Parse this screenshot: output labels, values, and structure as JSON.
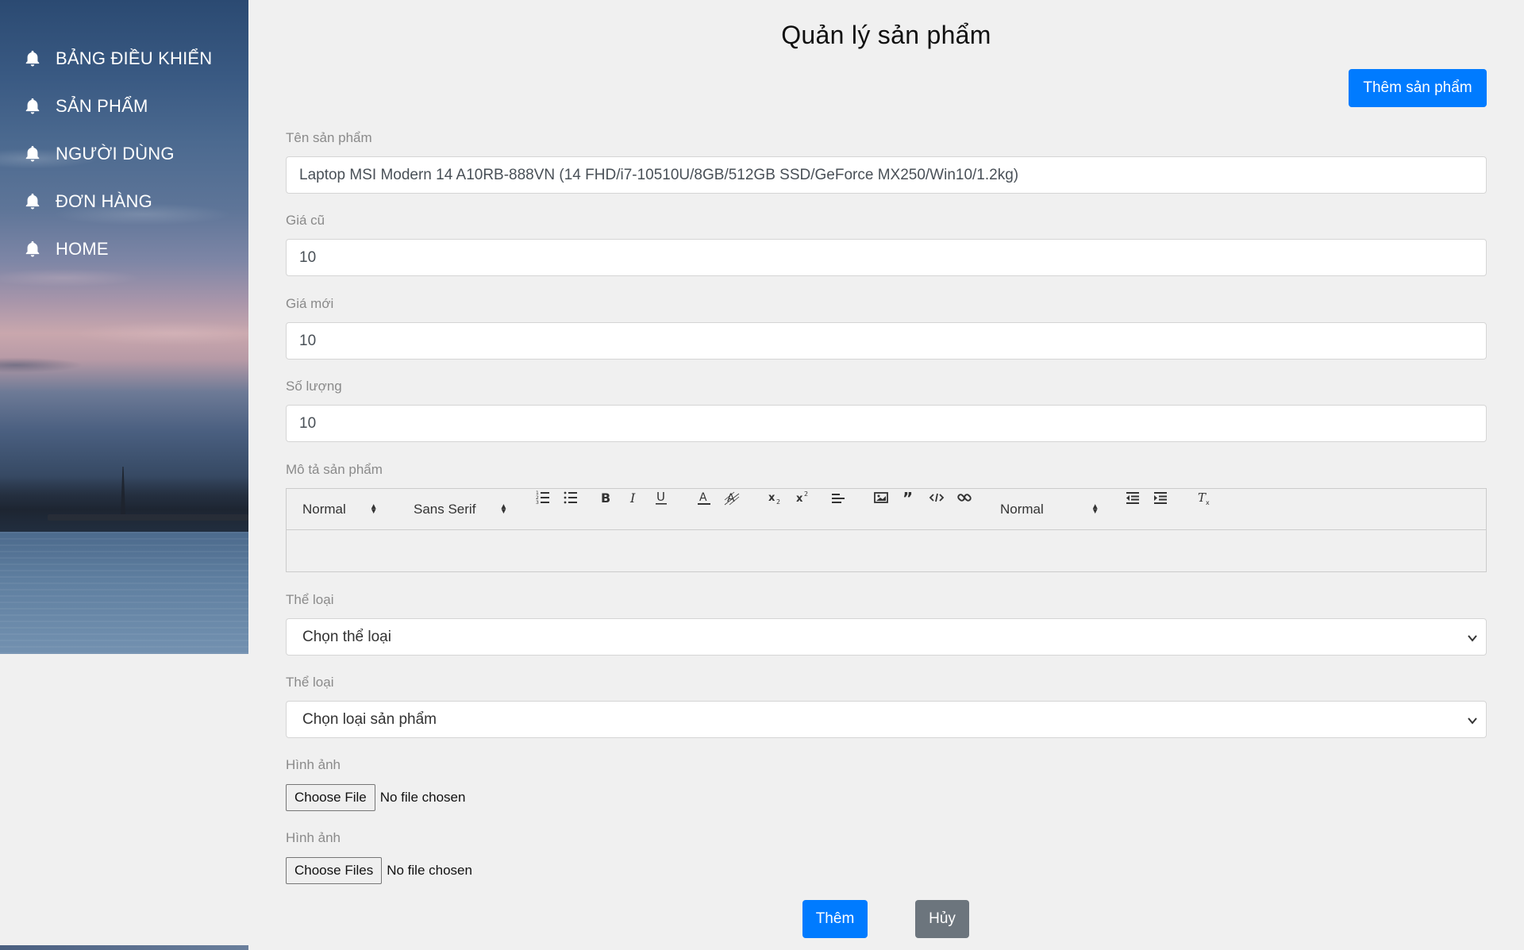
{
  "sidebar": {
    "items": [
      {
        "label": "BẢNG ĐIỀU KHIỂN",
        "icon": "bell-icon"
      },
      {
        "label": "SẢN PHẨM",
        "icon": "bell-icon"
      },
      {
        "label": "NGƯỜI DÙNG",
        "icon": "bell-icon"
      },
      {
        "label": "ĐƠN HÀNG",
        "icon": "bell-icon"
      },
      {
        "label": "HOME",
        "icon": "bell-icon"
      }
    ]
  },
  "main": {
    "title": "Quản lý sản phẩm",
    "add_button_label": "Thêm sản phẩm",
    "fields": {
      "name": {
        "label": "Tên sản phẩm",
        "value": "Laptop MSI Modern 14 A10RB-888VN (14 FHD/i7-10510U/8GB/512GB SSD/GeForce MX250/Win10/1.2kg)"
      },
      "old_price": {
        "label": "Giá cũ",
        "value": "10"
      },
      "new_price": {
        "label": "Giá mới",
        "value": "10"
      },
      "quantity": {
        "label": "Số lượng",
        "value": "10"
      },
      "description": {
        "label": "Mô tả sản phẩm",
        "toolbar": {
          "header_picker": "Normal",
          "font_picker": "Sans Serif",
          "size_picker": "Normal"
        }
      },
      "category": {
        "label": "Thể loại",
        "selected": "Chọn thể loại"
      },
      "product_type": {
        "label": "Thể loại",
        "selected": "Chọn loại sản phẩm"
      },
      "image": {
        "label": "Hình ảnh",
        "button": "Choose File",
        "status": "No file chosen"
      },
      "images": {
        "label": "Hình ảnh",
        "button": "Choose Files",
        "status": "No file chosen"
      }
    },
    "submit_label": "Thêm",
    "cancel_label": "Hủy"
  },
  "colors": {
    "primary": "#007bff",
    "secondary": "#6c757d",
    "background": "#f0f0f0"
  }
}
